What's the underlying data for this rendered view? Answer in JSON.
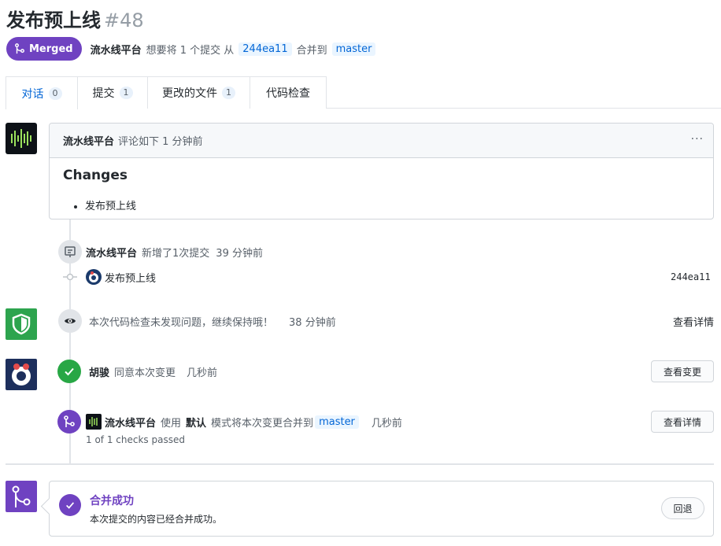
{
  "pr": {
    "title": "发布预上线",
    "number": "#48",
    "status": "Merged",
    "author": "流水线平台",
    "action_text": "想要将 1 个提交 从",
    "source_branch": "244ea11",
    "merge_into_text": "合并到",
    "target_branch": "master"
  },
  "tabs": [
    {
      "label": "对话",
      "count": "0"
    },
    {
      "label": "提交",
      "count": "1"
    },
    {
      "label": "更改的文件",
      "count": "1"
    },
    {
      "label": "代码检查"
    }
  ],
  "comment": {
    "author": "流水线平台",
    "meta": "评论如下 1 分钟前",
    "more": "···",
    "heading": "Changes",
    "items": [
      "发布预上线"
    ]
  },
  "commit_event": {
    "author": "流水线平台",
    "text": "新增了1次提交",
    "time": "39 分钟前",
    "commit_message": "发布预上线",
    "sha": "244ea11"
  },
  "review_event": {
    "text": "本次代码检查未发现问题，继续保持哦！",
    "time": "38 分钟前",
    "link": "查看详情"
  },
  "approve_event": {
    "author": "胡骏",
    "text": "同意本次变更",
    "time": "几秒前",
    "button": "查看变更"
  },
  "merge_event": {
    "author": "流水线平台",
    "text_use": "使用",
    "mode": "默认",
    "text_mode": "模式将本次变更合并到",
    "branch": "master",
    "time": "几秒前",
    "checks": "1 of 1 checks passed",
    "button": "查看详情"
  },
  "merge_result": {
    "title": "合并成功",
    "desc": "本次提交的内容已经合并成功。",
    "button": "回退"
  },
  "colors": {
    "merged": "#6f42c1",
    "link": "#0366d6",
    "success": "#28a745",
    "shield": "#2da44e"
  }
}
